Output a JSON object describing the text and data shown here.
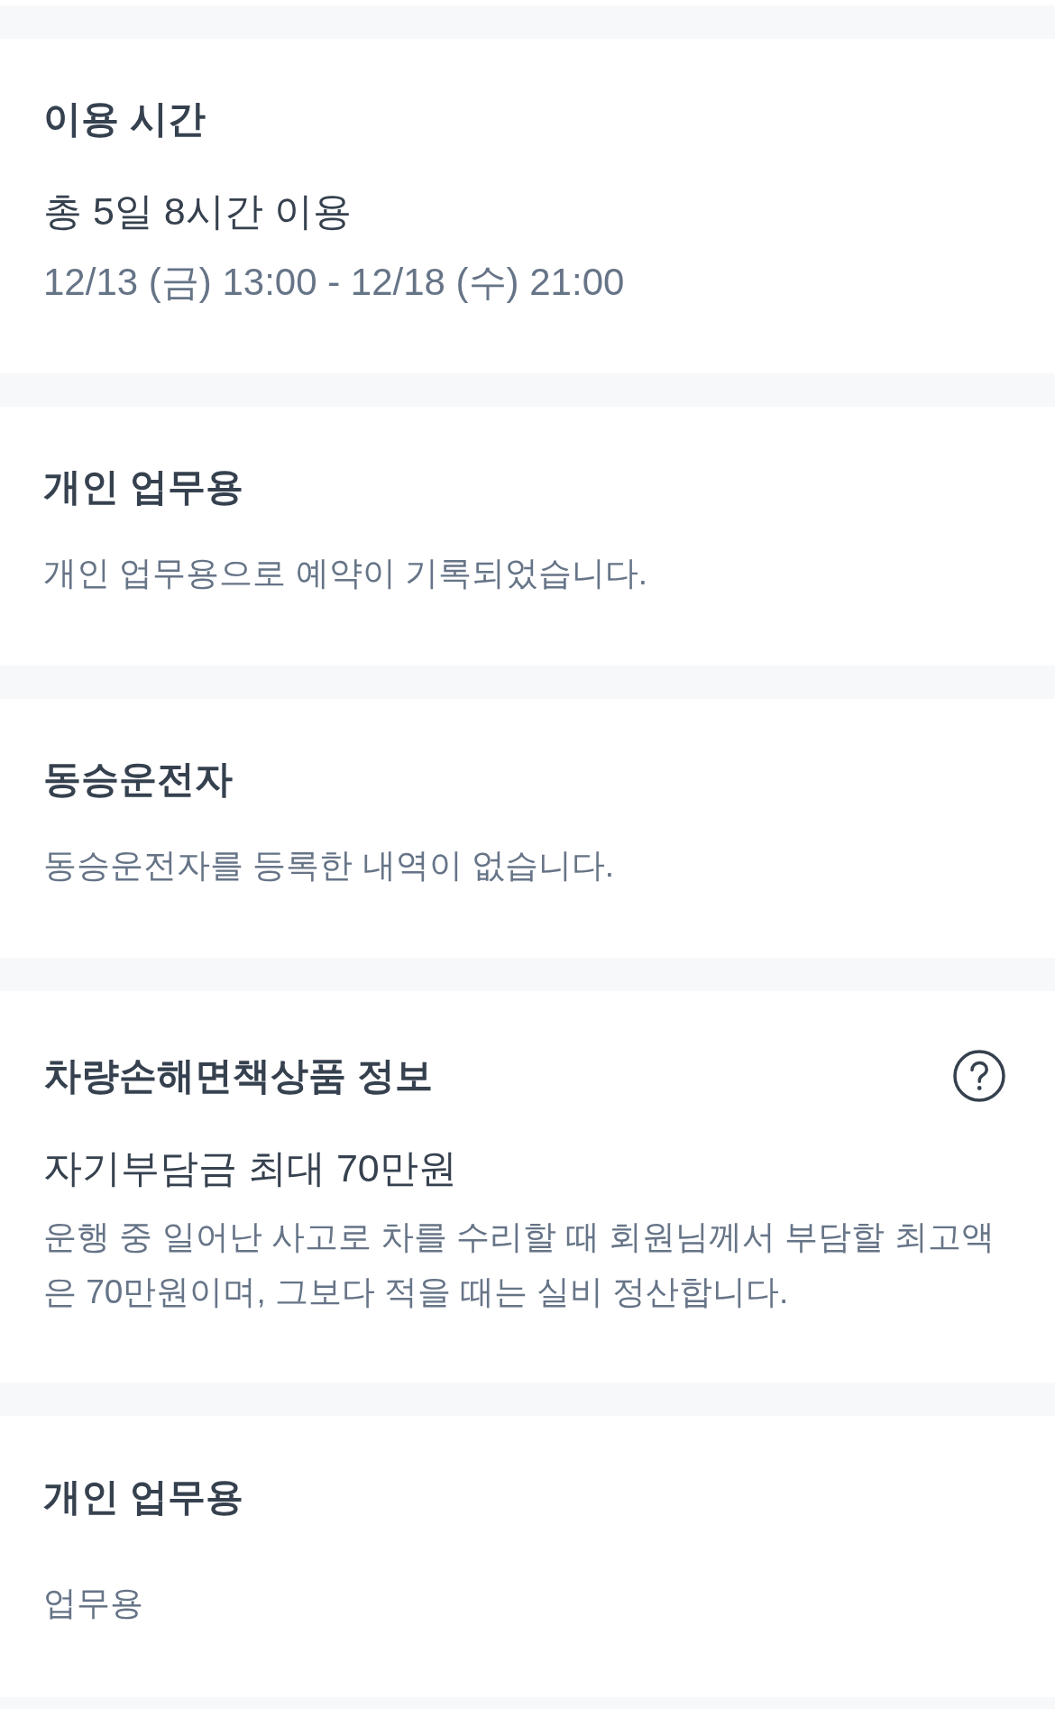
{
  "sections": [
    {
      "kind": "period",
      "title": "이용 시간",
      "summary": "총 5일 8시간 이용",
      "detail": "12/13 (금) 13:00 - 12/18 (수) 21:00"
    },
    {
      "kind": "note",
      "title": "개인 업무용",
      "detail": "개인 업무용으로 예약이 기록되었습니다."
    },
    {
      "kind": "note",
      "title": "동승운전자",
      "detail": "동승운전자를 등록한 내역이 없습니다."
    },
    {
      "kind": "coverage",
      "title": "차량손해면책상품 정보",
      "summary": "자기부담금 최대 70만원",
      "detail": "운행 중 일어난 사고로 차를 수리할 때 회원님께서 부담할 최고액은 70만원이며, 그보다 적을 때는 실비 정산합니다."
    },
    {
      "kind": "value",
      "title": "개인 업무용",
      "detail": "업무용"
    }
  ]
}
